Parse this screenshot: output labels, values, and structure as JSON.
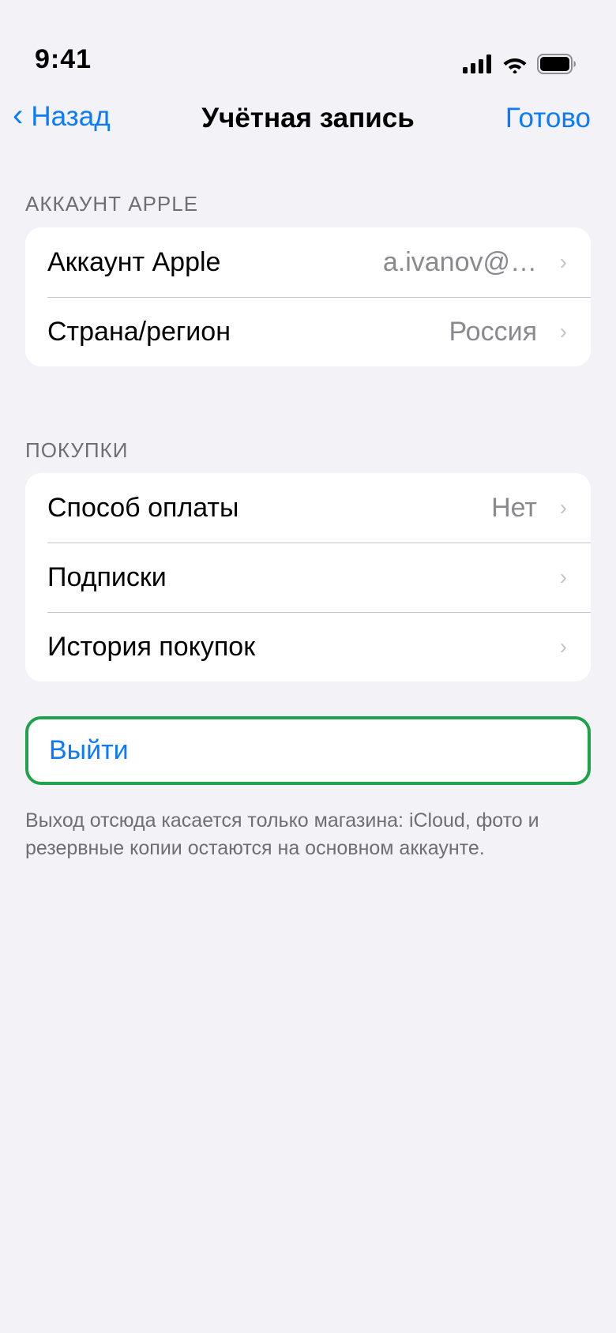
{
  "status_bar": {
    "time": "9:41",
    "icons": [
      "cellular-signal-icon",
      "wifi-icon",
      "battery-icon"
    ]
  },
  "nav": {
    "back_label": "Назад",
    "title": "Учётная запись",
    "done_label": "Готово"
  },
  "sections": {
    "apple_account": {
      "header": "АККАУНТ APPLE",
      "rows": [
        {
          "label": "Аккаунт Apple",
          "value": "a.ivanov@…"
        },
        {
          "label": "Страна/регион",
          "value": "Россия"
        }
      ]
    },
    "purchases": {
      "header": "ПОКУПКИ",
      "rows": [
        {
          "label": "Способ оплаты",
          "value": "Нет"
        },
        {
          "label": "Подписки",
          "value": ""
        },
        {
          "label": "История покупок",
          "value": ""
        }
      ]
    }
  },
  "sign_out": {
    "label": "Выйти"
  },
  "footnote": "Выход отсюда касается только магазина: iCloud, фото и резервные копии остаются на основном аккаунте.",
  "colors": {
    "accent": "#0a7aff",
    "background": "#f2f2f7",
    "highlight_border": "#1fa34a",
    "secondary_text": "#8a8a8e"
  }
}
